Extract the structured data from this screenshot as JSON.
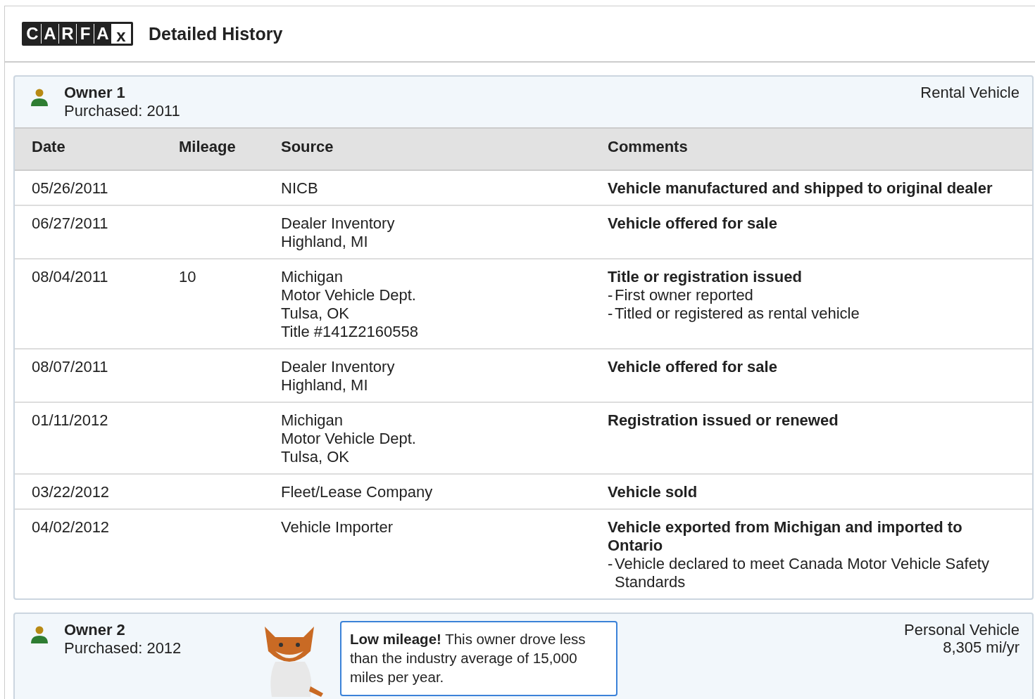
{
  "header": {
    "logo_letters": [
      "C",
      "A",
      "R",
      "F",
      "A",
      "x"
    ],
    "title": "Detailed History"
  },
  "owners": [
    {
      "name": "Owner 1",
      "purchased": "Purchased: 2011",
      "usage": [
        "Rental Vehicle"
      ],
      "columns": [
        "Date",
        "Mileage",
        "Source",
        "Comments"
      ],
      "rows": [
        {
          "date": "05/26/2011",
          "mileage": "",
          "source": [
            "NICB"
          ],
          "title": "Vehicle manufactured and shipped to original dealer",
          "notes": []
        },
        {
          "date": "06/27/2011",
          "mileage": "",
          "source": [
            "Dealer Inventory",
            "Highland, MI"
          ],
          "title": "Vehicle offered for sale",
          "notes": []
        },
        {
          "date": "08/04/2011",
          "mileage": "10",
          "source": [
            "Michigan",
            "Motor Vehicle Dept.",
            "Tulsa, OK",
            "Title #141Z2160558"
          ],
          "title": "Title or registration issued",
          "notes": [
            {
              "mark": "-",
              "text": "First owner reported"
            },
            {
              "mark": "-",
              "text": "Titled or registered as rental vehicle"
            }
          ]
        },
        {
          "date": "08/07/2011",
          "mileage": "",
          "source": [
            "Dealer Inventory",
            "Highland, MI"
          ],
          "title": "Vehicle offered for sale",
          "notes": []
        },
        {
          "date": "01/11/2012",
          "mileage": "",
          "source": [
            "Michigan",
            "Motor Vehicle Dept.",
            "Tulsa, OK"
          ],
          "title": "Registration issued or renewed",
          "notes": []
        },
        {
          "date": "03/22/2012",
          "mileage": "",
          "source": [
            "Fleet/Lease Company"
          ],
          "title": "Vehicle sold",
          "notes": []
        },
        {
          "date": "04/02/2012",
          "mileage": "",
          "source": [
            "Vehicle Importer"
          ],
          "title": "Vehicle exported from Michigan and imported to Ontario",
          "notes": [
            {
              "mark": "-",
              "text": "Vehicle declared to meet Canada Motor Vehicle Safety Standards"
            }
          ]
        }
      ]
    },
    {
      "name": "Owner 2",
      "purchased": "Purchased: 2012",
      "usage": [
        "Personal Vehicle",
        "8,305 mi/yr"
      ],
      "tip": "**Low mileage!** This owner drove less than the industry average of 15,000 miles per year."
    }
  ]
}
